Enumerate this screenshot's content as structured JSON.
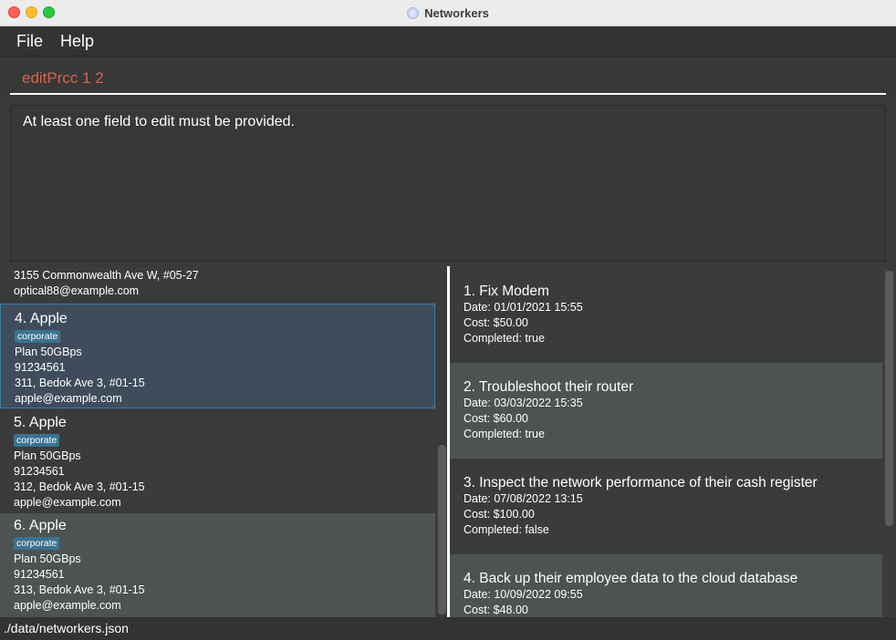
{
  "window": {
    "title": "Networkers",
    "app_icon": "networkers-app-icon"
  },
  "menu": {
    "file": "File",
    "help": "Help"
  },
  "command": {
    "value": "editPrcc 1 2",
    "value_color": "#d2634f"
  },
  "result": {
    "message": "At least one field to edit must be provided."
  },
  "persons": {
    "partial": {
      "address": "3155 Commonwealth Ave W, #05-27",
      "email": "optical88@example.com"
    },
    "items": [
      {
        "index_name": "4.  Apple",
        "tag": "corporate",
        "plan": "Plan 50GBps",
        "phone": "91234561",
        "address": "311, Bedok Ave 3, #01-15",
        "email": "apple@example.com"
      },
      {
        "index_name": "5.  Apple",
        "tag": "corporate",
        "plan": "Plan 50GBps",
        "phone": "91234561",
        "address": "312, Bedok Ave 3, #01-15",
        "email": "apple@example.com"
      },
      {
        "index_name": "6.  Apple",
        "tag": "corporate",
        "plan": "Plan 50GBps",
        "phone": "91234561",
        "address": "313, Bedok Ave 3, #01-15",
        "email": "apple@example.com"
      }
    ]
  },
  "tasks": {
    "items": [
      {
        "title": "1.  Fix Modem",
        "date": "Date: 01/01/2021 15:55",
        "cost": "Cost: $50.00",
        "completed": "Completed: true"
      },
      {
        "title": "2.  Troubleshoot their router",
        "date": "Date: 03/03/2022 15:35",
        "cost": "Cost: $60.00",
        "completed": "Completed: true"
      },
      {
        "title": "3.  Inspect the network performance of their cash register",
        "date": "Date: 07/08/2022 13:15",
        "cost": "Cost: $100.00",
        "completed": "Completed: false"
      },
      {
        "title": "4.  Back up their employee data to the cloud database",
        "date": "Date: 10/09/2022 09:55",
        "cost": "Cost: $48.00"
      }
    ]
  },
  "status": {
    "path": "./data/networkers.json"
  },
  "colors": {
    "selection_border": "#3a7ca8",
    "tag_bg": "#3c7290",
    "alt_row_bg": "#4d5253"
  }
}
